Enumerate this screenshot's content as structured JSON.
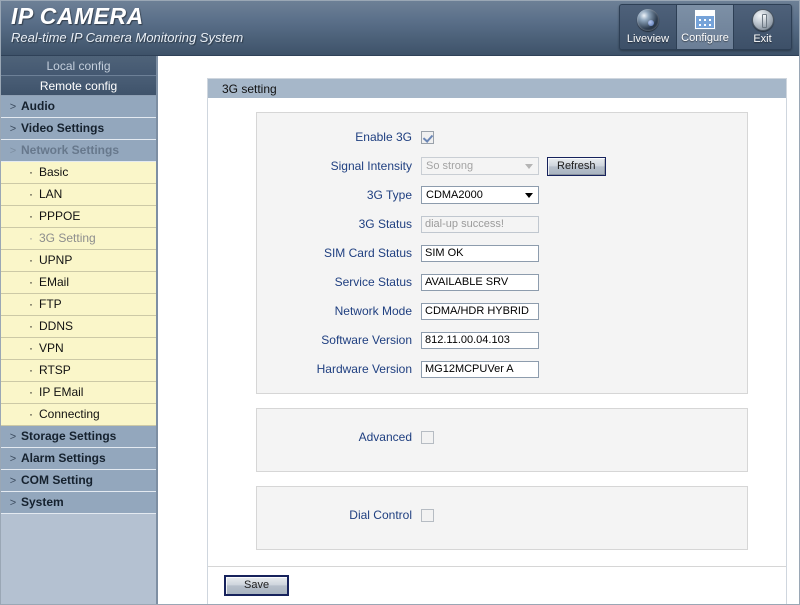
{
  "header": {
    "title": "IP CAMERA",
    "subtitle": "Real-time IP Camera Monitoring  System",
    "buttons": [
      {
        "label": "Liveview",
        "icon": "camera-lens-icon",
        "selected": false
      },
      {
        "label": "Configure",
        "icon": "calendar-grid-icon",
        "selected": true
      },
      {
        "label": "Exit",
        "icon": "power-icon",
        "selected": false
      }
    ]
  },
  "sidebar": {
    "local_config": "Local config",
    "remote_config": "Remote config",
    "items": [
      {
        "label": "Audio",
        "type": "category",
        "marker": ">",
        "dim": false
      },
      {
        "label": "Video Settings",
        "type": "category",
        "marker": ">",
        "dim": false
      },
      {
        "label": "Network Settings",
        "type": "category",
        "marker": ">",
        "dim": true
      },
      {
        "label": "Basic",
        "type": "sub",
        "marker": "·",
        "dim": false
      },
      {
        "label": "LAN",
        "type": "sub",
        "marker": "·",
        "dim": false
      },
      {
        "label": "PPPOE",
        "type": "sub",
        "marker": "·",
        "dim": false
      },
      {
        "label": "3G Setting",
        "type": "sub",
        "marker": "·",
        "dim": true
      },
      {
        "label": "UPNP",
        "type": "sub",
        "marker": "·",
        "dim": false
      },
      {
        "label": "EMail",
        "type": "sub",
        "marker": "·",
        "dim": false
      },
      {
        "label": "FTP",
        "type": "sub",
        "marker": "·",
        "dim": false
      },
      {
        "label": "DDNS",
        "type": "sub",
        "marker": "·",
        "dim": false
      },
      {
        "label": "VPN",
        "type": "sub",
        "marker": "·",
        "dim": false
      },
      {
        "label": "RTSP",
        "type": "sub",
        "marker": "·",
        "dim": false
      },
      {
        "label": "IP EMail",
        "type": "sub",
        "marker": "·",
        "dim": false
      },
      {
        "label": "Connecting",
        "type": "sub",
        "marker": "·",
        "dim": false
      },
      {
        "label": "Storage Settings",
        "type": "category",
        "marker": ">",
        "dim": false
      },
      {
        "label": "Alarm Settings",
        "type": "category",
        "marker": ">",
        "dim": false
      },
      {
        "label": "COM Setting",
        "type": "category",
        "marker": ">",
        "dim": false
      },
      {
        "label": "System",
        "type": "category",
        "marker": ">",
        "dim": false
      }
    ]
  },
  "panel": {
    "title": "3G setting",
    "fields": {
      "enable_3g": {
        "label": "Enable 3G",
        "checked": true
      },
      "signal_intensity": {
        "label": "Signal Intensity",
        "value": "So strong",
        "disabled": true
      },
      "refresh_button": "Refresh",
      "type_3g": {
        "label": "3G Type",
        "value": "CDMA2000",
        "disabled": false
      },
      "status_3g": {
        "label": "3G Status",
        "value": "dial-up success!",
        "disabled": true
      },
      "sim_card_status": {
        "label": "SIM Card Status",
        "value": "SIM OK",
        "disabled": false
      },
      "service_status": {
        "label": "Service Status",
        "value": "AVAILABLE SRV",
        "disabled": false
      },
      "network_mode": {
        "label": "Network Mode",
        "value": "CDMA/HDR HYBRID",
        "disabled": false
      },
      "software_version": {
        "label": "Software Version",
        "value": "812.11.00.04.103",
        "disabled": false
      },
      "hardware_version": {
        "label": "Hardware Version",
        "value": "MG12MCPUVer A",
        "disabled": false
      },
      "advanced": {
        "label": "Advanced",
        "checked": false
      },
      "dial_control": {
        "label": "Dial Control",
        "checked": false
      }
    },
    "save_button": "Save"
  },
  "colors": {
    "header_blue": "#4b6078",
    "panel_head": "#a6b7c9",
    "sidebar_bg": "#b4c1d1",
    "sidebar_category": "#93a7bd",
    "sidebar_sub": "#faf6c9",
    "label_blue": "#1f3f80",
    "button_border": "#16225c"
  }
}
